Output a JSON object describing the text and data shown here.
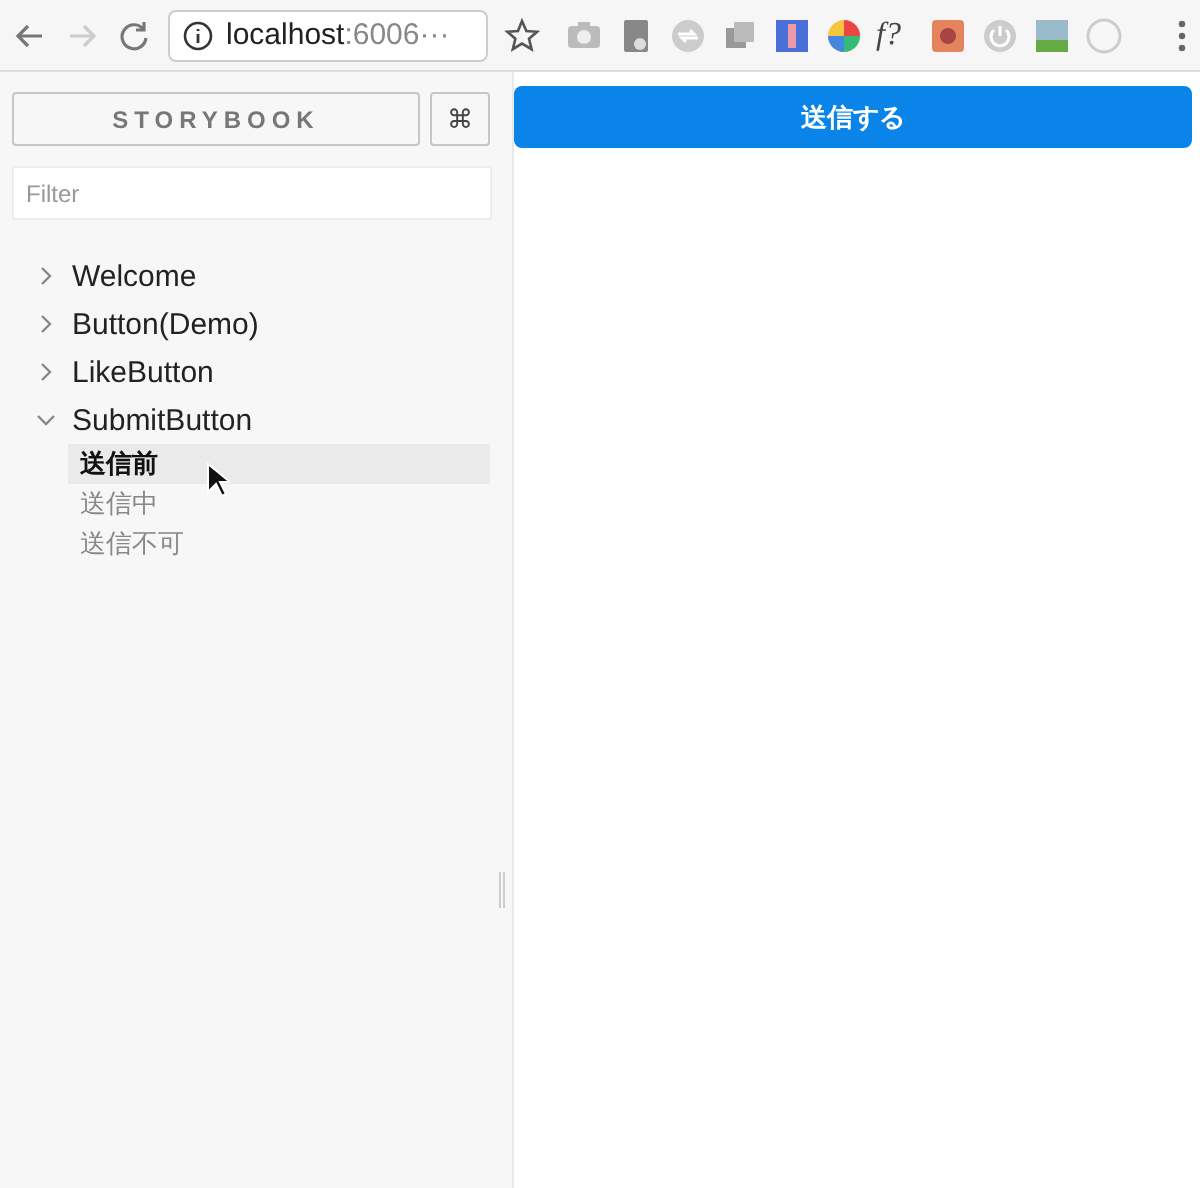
{
  "browser": {
    "address": {
      "host": "localhost",
      "rest": ":6006···"
    },
    "forward_disabled": true,
    "extensions": [
      {
        "kind": "camera"
      },
      {
        "kind": "mail"
      },
      {
        "kind": "sync"
      },
      {
        "kind": "layers"
      },
      {
        "kind": "tile"
      },
      {
        "kind": "wheel"
      },
      {
        "kind": "text",
        "label": "f?"
      },
      {
        "kind": "tile2"
      },
      {
        "kind": "power"
      },
      {
        "kind": "tile3"
      },
      {
        "kind": "ring"
      }
    ]
  },
  "sidebar": {
    "title": "STORYBOOK",
    "shortcut": "⌘",
    "filter": {
      "placeholder": "Filter"
    },
    "tree": [
      {
        "label": "Welcome",
        "expanded": false
      },
      {
        "label": "Button(Demo)",
        "expanded": false
      },
      {
        "label": "LikeButton",
        "expanded": false
      },
      {
        "label": "SubmitButton",
        "expanded": true,
        "children": [
          {
            "label": "送信前",
            "selected": true
          },
          {
            "label": "送信中",
            "selected": false
          },
          {
            "label": "送信不可",
            "selected": false
          }
        ]
      }
    ]
  },
  "preview": {
    "button": "送信する"
  }
}
